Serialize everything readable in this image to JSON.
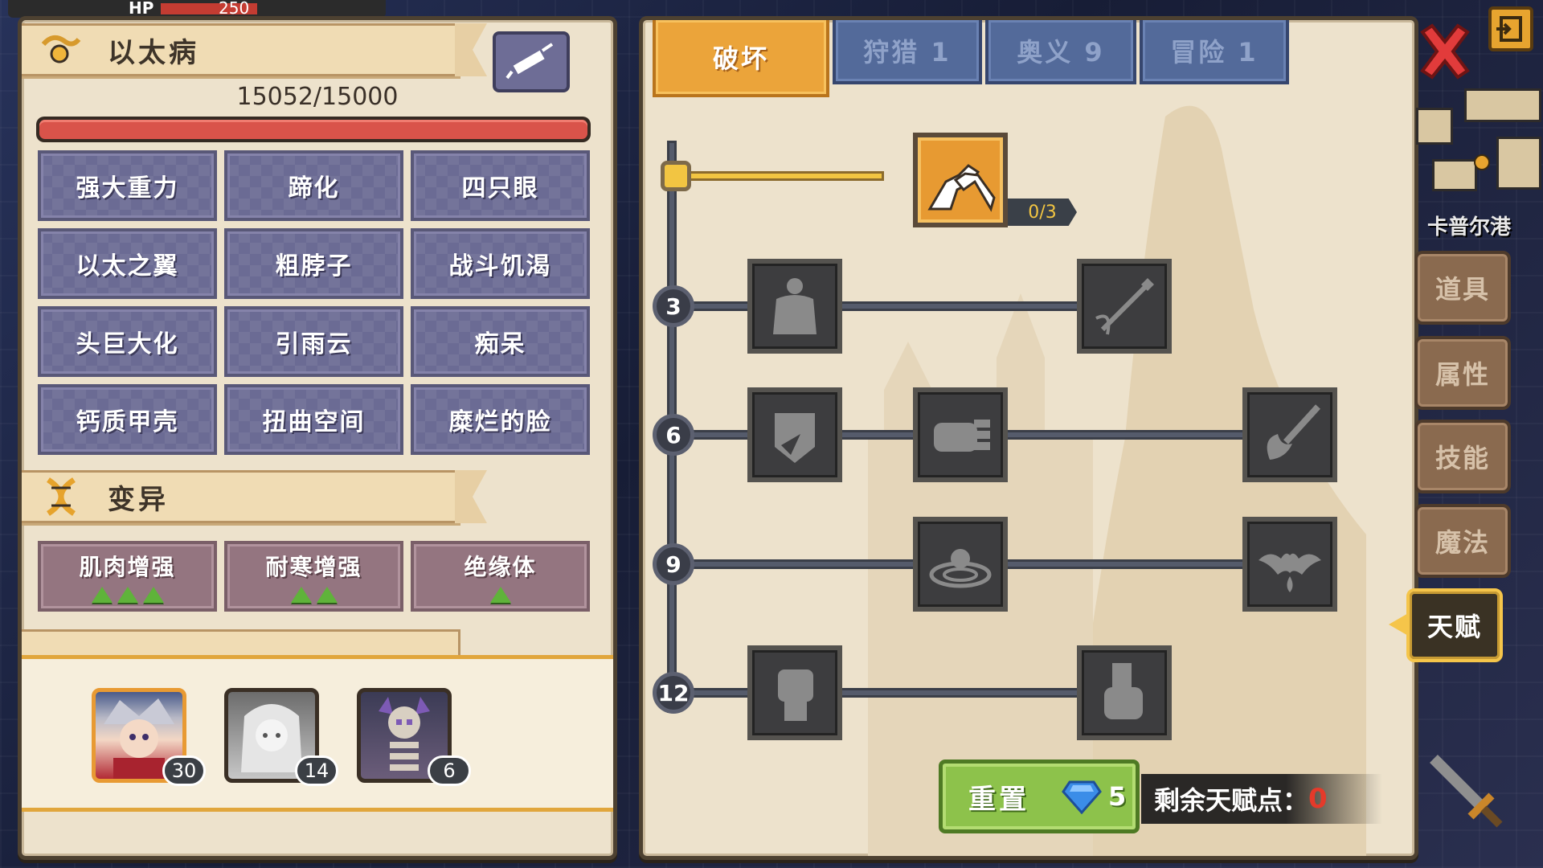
{
  "hud": {
    "hp_label": "HP",
    "hp_value": "250"
  },
  "left": {
    "disease_title": "以太病",
    "hp_text": "15052/15000",
    "hp_fraction": 1.0,
    "traits": [
      "强大重力",
      "蹄化",
      "四只眼",
      "以太之翼",
      "粗脖子",
      "战斗饥渴",
      "头巨大化",
      "引雨云",
      "痴呆",
      "钙质甲壳",
      "扭曲空间",
      "糜烂的脸"
    ],
    "mutation_title": "变异",
    "mutations": [
      {
        "label": "肌肉增强",
        "stars": 3
      },
      {
        "label": "耐寒增强",
        "stars": 2
      },
      {
        "label": "绝缘体",
        "stars": 1
      }
    ],
    "party": [
      {
        "name": "hero-portrait",
        "level": "30"
      },
      {
        "name": "ghost-girl-portrait",
        "level": "14"
      },
      {
        "name": "skeleton-portrait",
        "level": "6"
      }
    ]
  },
  "tabs": [
    {
      "label": "破坏",
      "active": true
    },
    {
      "label": "狩猎 1",
      "active": false
    },
    {
      "label": "奥义 9",
      "active": false
    },
    {
      "label": "冒险 1",
      "active": false
    }
  ],
  "tree": {
    "tiers": [
      "3",
      "6",
      "9",
      "12"
    ],
    "first_node_progress": "0/3",
    "nodes": [
      "arm-wrestle-icon",
      "body-silhouette-icon",
      "arrow-icon",
      "shield-icon",
      "fist-punch-icon",
      "splash-attack-icon",
      "ripple-icon",
      "bat-icon",
      "raised-fist-icon",
      "hanging-fist-icon"
    ]
  },
  "footer": {
    "reset_label": "重置",
    "reset_cost": "5",
    "remaining_label": "剩余天赋点：",
    "remaining_value": "0"
  },
  "side_tabs": [
    "道具",
    "属性",
    "技能",
    "魔法",
    "天赋"
  ],
  "minimap": {
    "location": "卡普尔港"
  },
  "colors": {
    "accent": "#eba43a",
    "hp_red": "#d9534a",
    "remaining_red": "#e53a2a"
  }
}
